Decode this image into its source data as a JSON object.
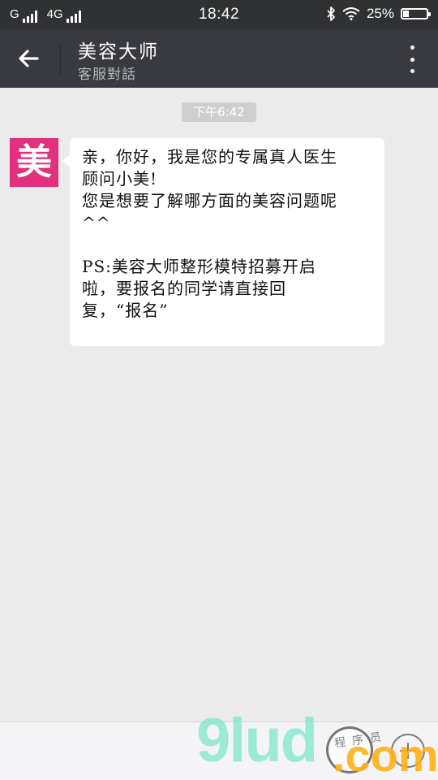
{
  "status_bar": {
    "carrier1": "G",
    "carrier2": "4G",
    "time": "18:42",
    "battery": "25%",
    "battery_level": 0.25
  },
  "header": {
    "title": "美容大师",
    "subtitle": "客服對話"
  },
  "chat": {
    "timestamp": "下午6:42",
    "avatar_char": "美",
    "message_lines": [
      "亲，你好，我是您的专属真人医生",
      "顾问小美!",
      "您是想要了解哪方面的美容问题呢",
      "^^",
      "",
      "PS:美容大师整形模特招募开启",
      "啦，要报名的同学请直接回",
      "复，“报名”"
    ]
  },
  "watermark": {
    "brand": "9lud",
    "suffix": ".com",
    "small_text": "程序员"
  },
  "colors": {
    "status_bar": "#2f3133",
    "title_bar": "#393a3f",
    "background": "#ebebeb",
    "avatar": "#e2307c",
    "timestamp_bg": "#cecece"
  },
  "icons": {
    "back": "arrow-left-icon",
    "more": "more-vertical-icon",
    "plus": "plus-circle-icon",
    "bluetooth": "bluetooth-icon",
    "wifi": "wifi-icon",
    "battery": "battery-icon"
  }
}
